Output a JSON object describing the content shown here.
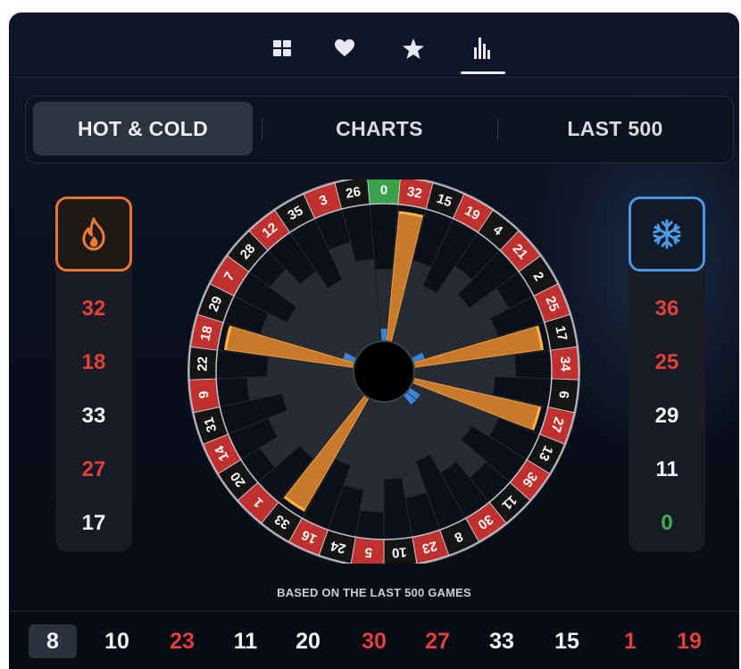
{
  "topbar": {
    "icons": [
      "grid-icon",
      "heart-icon",
      "star-icon",
      "stats-icon"
    ],
    "active": "stats-icon"
  },
  "tabs": [
    {
      "label": "HOT & COLD",
      "active": true
    },
    {
      "label": "CHARTS",
      "active": false
    },
    {
      "label": "LAST 500",
      "active": false
    }
  ],
  "hot": {
    "icon": "fire-icon",
    "numbers": [
      {
        "value": "32",
        "color": "red"
      },
      {
        "value": "18",
        "color": "red"
      },
      {
        "value": "33",
        "color": "white"
      },
      {
        "value": "27",
        "color": "red"
      },
      {
        "value": "17",
        "color": "white"
      }
    ]
  },
  "cold": {
    "icon": "snowflake-icon",
    "numbers": [
      {
        "value": "36",
        "color": "red"
      },
      {
        "value": "25",
        "color": "red"
      },
      {
        "value": "29",
        "color": "white"
      },
      {
        "value": "11",
        "color": "white"
      },
      {
        "value": "0",
        "color": "green"
      }
    ]
  },
  "wheel": {
    "sequence": [
      "0",
      "32",
      "15",
      "19",
      "4",
      "21",
      "2",
      "25",
      "17",
      "34",
      "6",
      "27",
      "13",
      "36",
      "11",
      "30",
      "8",
      "23",
      "10",
      "5",
      "24",
      "16",
      "33",
      "1",
      "20",
      "14",
      "31",
      "9",
      "22",
      "18",
      "29",
      "7",
      "28",
      "12",
      "35",
      "3",
      "26"
    ],
    "red_numbers": [
      1,
      3,
      5,
      7,
      9,
      12,
      14,
      16,
      18,
      19,
      21,
      23,
      25,
      27,
      30,
      32,
      34,
      36
    ],
    "hot_highlight": [
      "32",
      "18",
      "33",
      "27",
      "17"
    ],
    "cold_highlight": [
      "36",
      "25",
      "29",
      "11",
      "0"
    ]
  },
  "footnote": "BASED ON THE LAST 500 GAMES",
  "history": [
    {
      "value": "8",
      "color": "white"
    },
    {
      "value": "10",
      "color": "white"
    },
    {
      "value": "23",
      "color": "red"
    },
    {
      "value": "11",
      "color": "white"
    },
    {
      "value": "20",
      "color": "white"
    },
    {
      "value": "30",
      "color": "red"
    },
    {
      "value": "27",
      "color": "red"
    },
    {
      "value": "33",
      "color": "white"
    },
    {
      "value": "15",
      "color": "white"
    },
    {
      "value": "1",
      "color": "red"
    },
    {
      "value": "19",
      "color": "red"
    }
  ],
  "colors": {
    "red": "#c0302f",
    "black": "#141414",
    "green": "#3aa14a",
    "hot": "#f0963a",
    "cold": "#3d82d6"
  }
}
